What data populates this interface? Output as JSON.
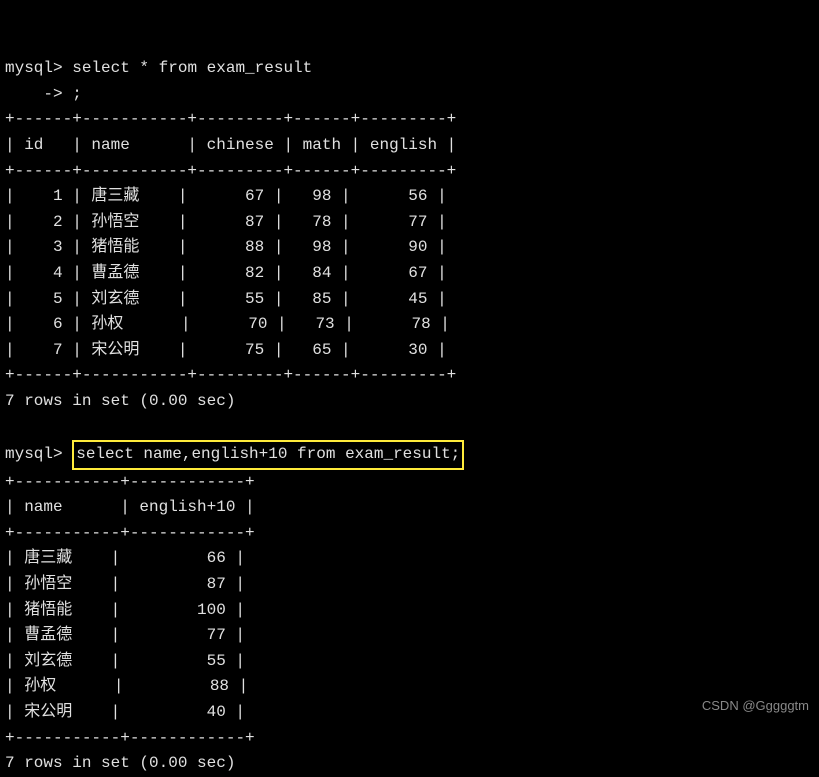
{
  "prompt1": "mysql> ",
  "query1_line1": "select * from exam_result",
  "prompt1_cont": "    -> ",
  "query1_line2": ";",
  "table1": {
    "sep": "+------+-----------+---------+------+---------+",
    "header": "| id   | name      | chinese | math | english |",
    "rows": [
      "|    1 | 唐三藏    |      67 |   98 |      56 |",
      "|    2 | 孙悟空    |      87 |   78 |      77 |",
      "|    3 | 猪悟能    |      88 |   98 |      90 |",
      "|    4 | 曹孟德    |      82 |   84 |      67 |",
      "|    5 | 刘玄德    |      55 |   85 |      45 |",
      "|    6 | 孙权      |      70 |   73 |      78 |",
      "|    7 | 宋公明    |      75 |   65 |      30 |"
    ]
  },
  "result1": "7 rows in set (0.00 sec)",
  "prompt2": "mysql> ",
  "query2": "select name,english+10 from exam_result;",
  "table2": {
    "sep": "+-----------+------------+",
    "header": "| name      | english+10 |",
    "rows": [
      "| 唐三藏    |         66 |",
      "| 孙悟空    |         87 |",
      "| 猪悟能    |        100 |",
      "| 曹孟德    |         77 |",
      "| 刘玄德    |         55 |",
      "| 孙权      |         88 |",
      "| 宋公明    |         40 |"
    ]
  },
  "result2": "7 rows in set (0.00 sec)",
  "watermark": "CSDN @Gggggtm",
  "chart_data": {
    "type": "table",
    "tables": [
      {
        "title": "exam_result",
        "columns": [
          "id",
          "name",
          "chinese",
          "math",
          "english"
        ],
        "rows": [
          [
            1,
            "唐三藏",
            67,
            98,
            56
          ],
          [
            2,
            "孙悟空",
            87,
            78,
            77
          ],
          [
            3,
            "猪悟能",
            88,
            98,
            90
          ],
          [
            4,
            "曹孟德",
            82,
            84,
            67
          ],
          [
            5,
            "刘玄德",
            55,
            85,
            45
          ],
          [
            6,
            "孙权",
            70,
            73,
            78
          ],
          [
            7,
            "宋公明",
            75,
            65,
            30
          ]
        ]
      },
      {
        "title": "name, english+10",
        "columns": [
          "name",
          "english+10"
        ],
        "rows": [
          [
            "唐三藏",
            66
          ],
          [
            "孙悟空",
            87
          ],
          [
            "猪悟能",
            100
          ],
          [
            "曹孟德",
            77
          ],
          [
            "刘玄德",
            55
          ],
          [
            "孙权",
            88
          ],
          [
            "宋公明",
            40
          ]
        ]
      }
    ]
  }
}
